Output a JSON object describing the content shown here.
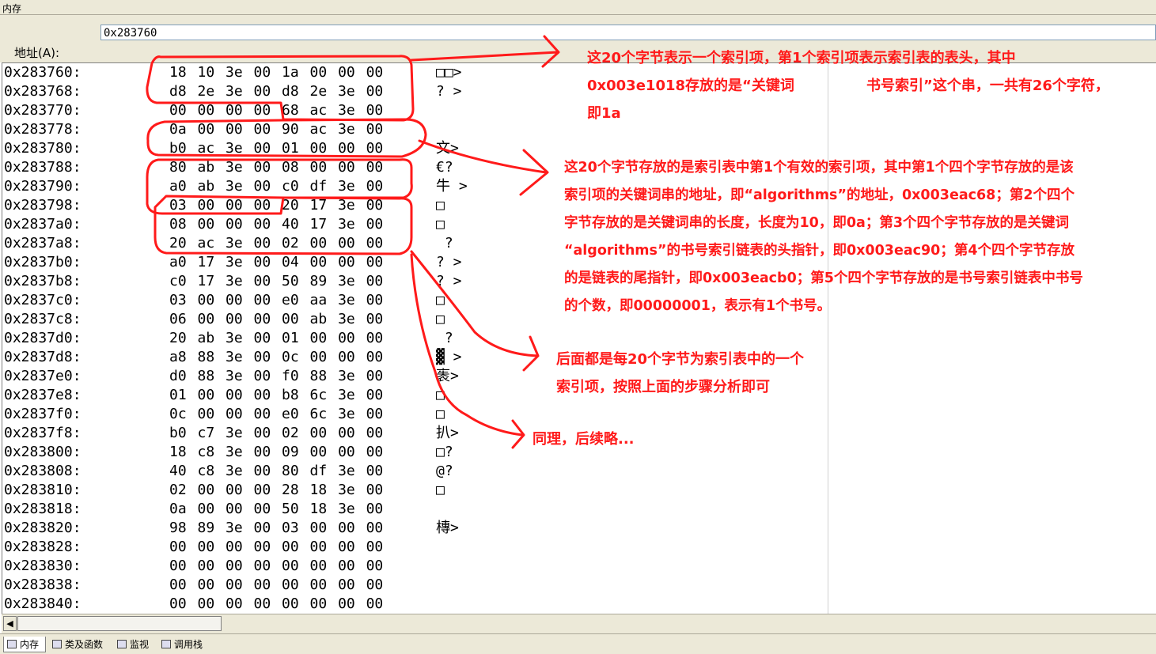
{
  "window": {
    "title": "内存"
  },
  "address": {
    "label": "地址(A):",
    "value": "0x283760"
  },
  "memory_rows": [
    {
      "addr": "0x283760:",
      "bytes": "18 10 3e 00 1a 00 00 00",
      "ascii": "□□>"
    },
    {
      "addr": "0x283768:",
      "bytes": "d8 2e 3e 00 d8 2e 3e 00",
      "ascii": "? >"
    },
    {
      "addr": "0x283770:",
      "bytes": "00 00 00 00 68 ac 3e 00",
      "ascii": ""
    },
    {
      "addr": "0x283778:",
      "bytes": "0a 00 00 00 90 ac 3e 00",
      "ascii": ""
    },
    {
      "addr": "0x283780:",
      "bytes": "b0 ac 3e 00 01 00 00 00",
      "ascii": "文>"
    },
    {
      "addr": "0x283788:",
      "bytes": "80 ab 3e 00 08 00 00 00",
      "ascii": "€?"
    },
    {
      "addr": "0x283790:",
      "bytes": "a0 ab 3e 00 c0 df 3e 00",
      "ascii": "牛 >"
    },
    {
      "addr": "0x283798:",
      "bytes": "03 00 00 00 20 17 3e 00",
      "ascii": "□"
    },
    {
      "addr": "0x2837a0:",
      "bytes": "08 00 00 00 40 17 3e 00",
      "ascii": "□"
    },
    {
      "addr": "0x2837a8:",
      "bytes": "20 ac 3e 00 02 00 00 00",
      "ascii": " ?"
    },
    {
      "addr": "0x2837b0:",
      "bytes": "a0 17 3e 00 04 00 00 00",
      "ascii": "? >"
    },
    {
      "addr": "0x2837b8:",
      "bytes": "c0 17 3e 00 50 89 3e 00",
      "ascii": "? >"
    },
    {
      "addr": "0x2837c0:",
      "bytes": "03 00 00 00 e0 aa 3e 00",
      "ascii": "□"
    },
    {
      "addr": "0x2837c8:",
      "bytes": "06 00 00 00 00 ab 3e 00",
      "ascii": "□"
    },
    {
      "addr": "0x2837d0:",
      "bytes": "20 ab 3e 00 01 00 00 00",
      "ascii": " ?"
    },
    {
      "addr": "0x2837d8:",
      "bytes": "a8 88 3e 00 0c 00 00 00",
      "ascii": "▓ >"
    },
    {
      "addr": "0x2837e0:",
      "bytes": "d0 88 3e 00 f0 88 3e 00",
      "ascii": "袠>"
    },
    {
      "addr": "0x2837e8:",
      "bytes": "01 00 00 00 b8 6c 3e 00",
      "ascii": "□"
    },
    {
      "addr": "0x2837f0:",
      "bytes": "0c 00 00 00 e0 6c 3e 00",
      "ascii": "□"
    },
    {
      "addr": "0x2837f8:",
      "bytes": "b0 c7 3e 00 02 00 00 00",
      "ascii": "扒>"
    },
    {
      "addr": "0x283800:",
      "bytes": "18 c8 3e 00 09 00 00 00",
      "ascii": "□?"
    },
    {
      "addr": "0x283808:",
      "bytes": "40 c8 3e 00 80 df 3e 00",
      "ascii": "@?"
    },
    {
      "addr": "0x283810:",
      "bytes": "02 00 00 00 28 18 3e 00",
      "ascii": "□"
    },
    {
      "addr": "0x283818:",
      "bytes": "0a 00 00 00 50 18 3e 00",
      "ascii": ""
    },
    {
      "addr": "0x283820:",
      "bytes": "98 89 3e 00 03 00 00 00",
      "ascii": "槫>"
    },
    {
      "addr": "0x283828:",
      "bytes": "00 00 00 00 00 00 00 00",
      "ascii": ""
    },
    {
      "addr": "0x283830:",
      "bytes": "00 00 00 00 00 00 00 00",
      "ascii": ""
    },
    {
      "addr": "0x283838:",
      "bytes": "00 00 00 00 00 00 00 00",
      "ascii": ""
    },
    {
      "addr": "0x283840:",
      "bytes": "00 00 00 00 00 00 00 00",
      "ascii": ""
    }
  ],
  "annotations": {
    "a1": {
      "l1": "这20个字节表示一个索引项，第1个索引项表示索引表的表头，其中",
      "l2a": "0x003e1018存放的是“关键词",
      "l2b": "书号索引”这个串，一共有26个字符，",
      "l3": "即1a"
    },
    "a2": {
      "l1": "这20个字节存放的是索引表中第1个有效的索引项，其中第1个四个字节存放的是该",
      "l2": "索引项的关键词串的地址，即“algorithms”的地址，0x003eac68；第2个四个",
      "l3": "字节存放的是关键词串的长度，长度为10，即0a；第3个四个字节存放的是关键词",
      "l4": "“algorithms”的书号索引链表的头指针，即0x003eac90；第4个四个字节存放",
      "l5": "的是链表的尾指针，即0x003eacb0；第5个四个字节存放的是书号索引链表中书号",
      "l6": "的个数，即00000001，表示有1个书号。"
    },
    "a3": {
      "l1": "后面都是每20个字节为索引表中的一个",
      "l2": "索引项，按照上面的步骤分析即可"
    },
    "a4": {
      "l1": "同理，后续略..."
    }
  },
  "tabs": [
    {
      "label": "内存"
    },
    {
      "label": "类及函数"
    },
    {
      "label": "监视"
    },
    {
      "label": "调用栈"
    }
  ],
  "scroll": {
    "left_arrow": "◀"
  },
  "colors": {
    "annotation": "#ff1a1a",
    "chrome": "#ece9d8"
  }
}
